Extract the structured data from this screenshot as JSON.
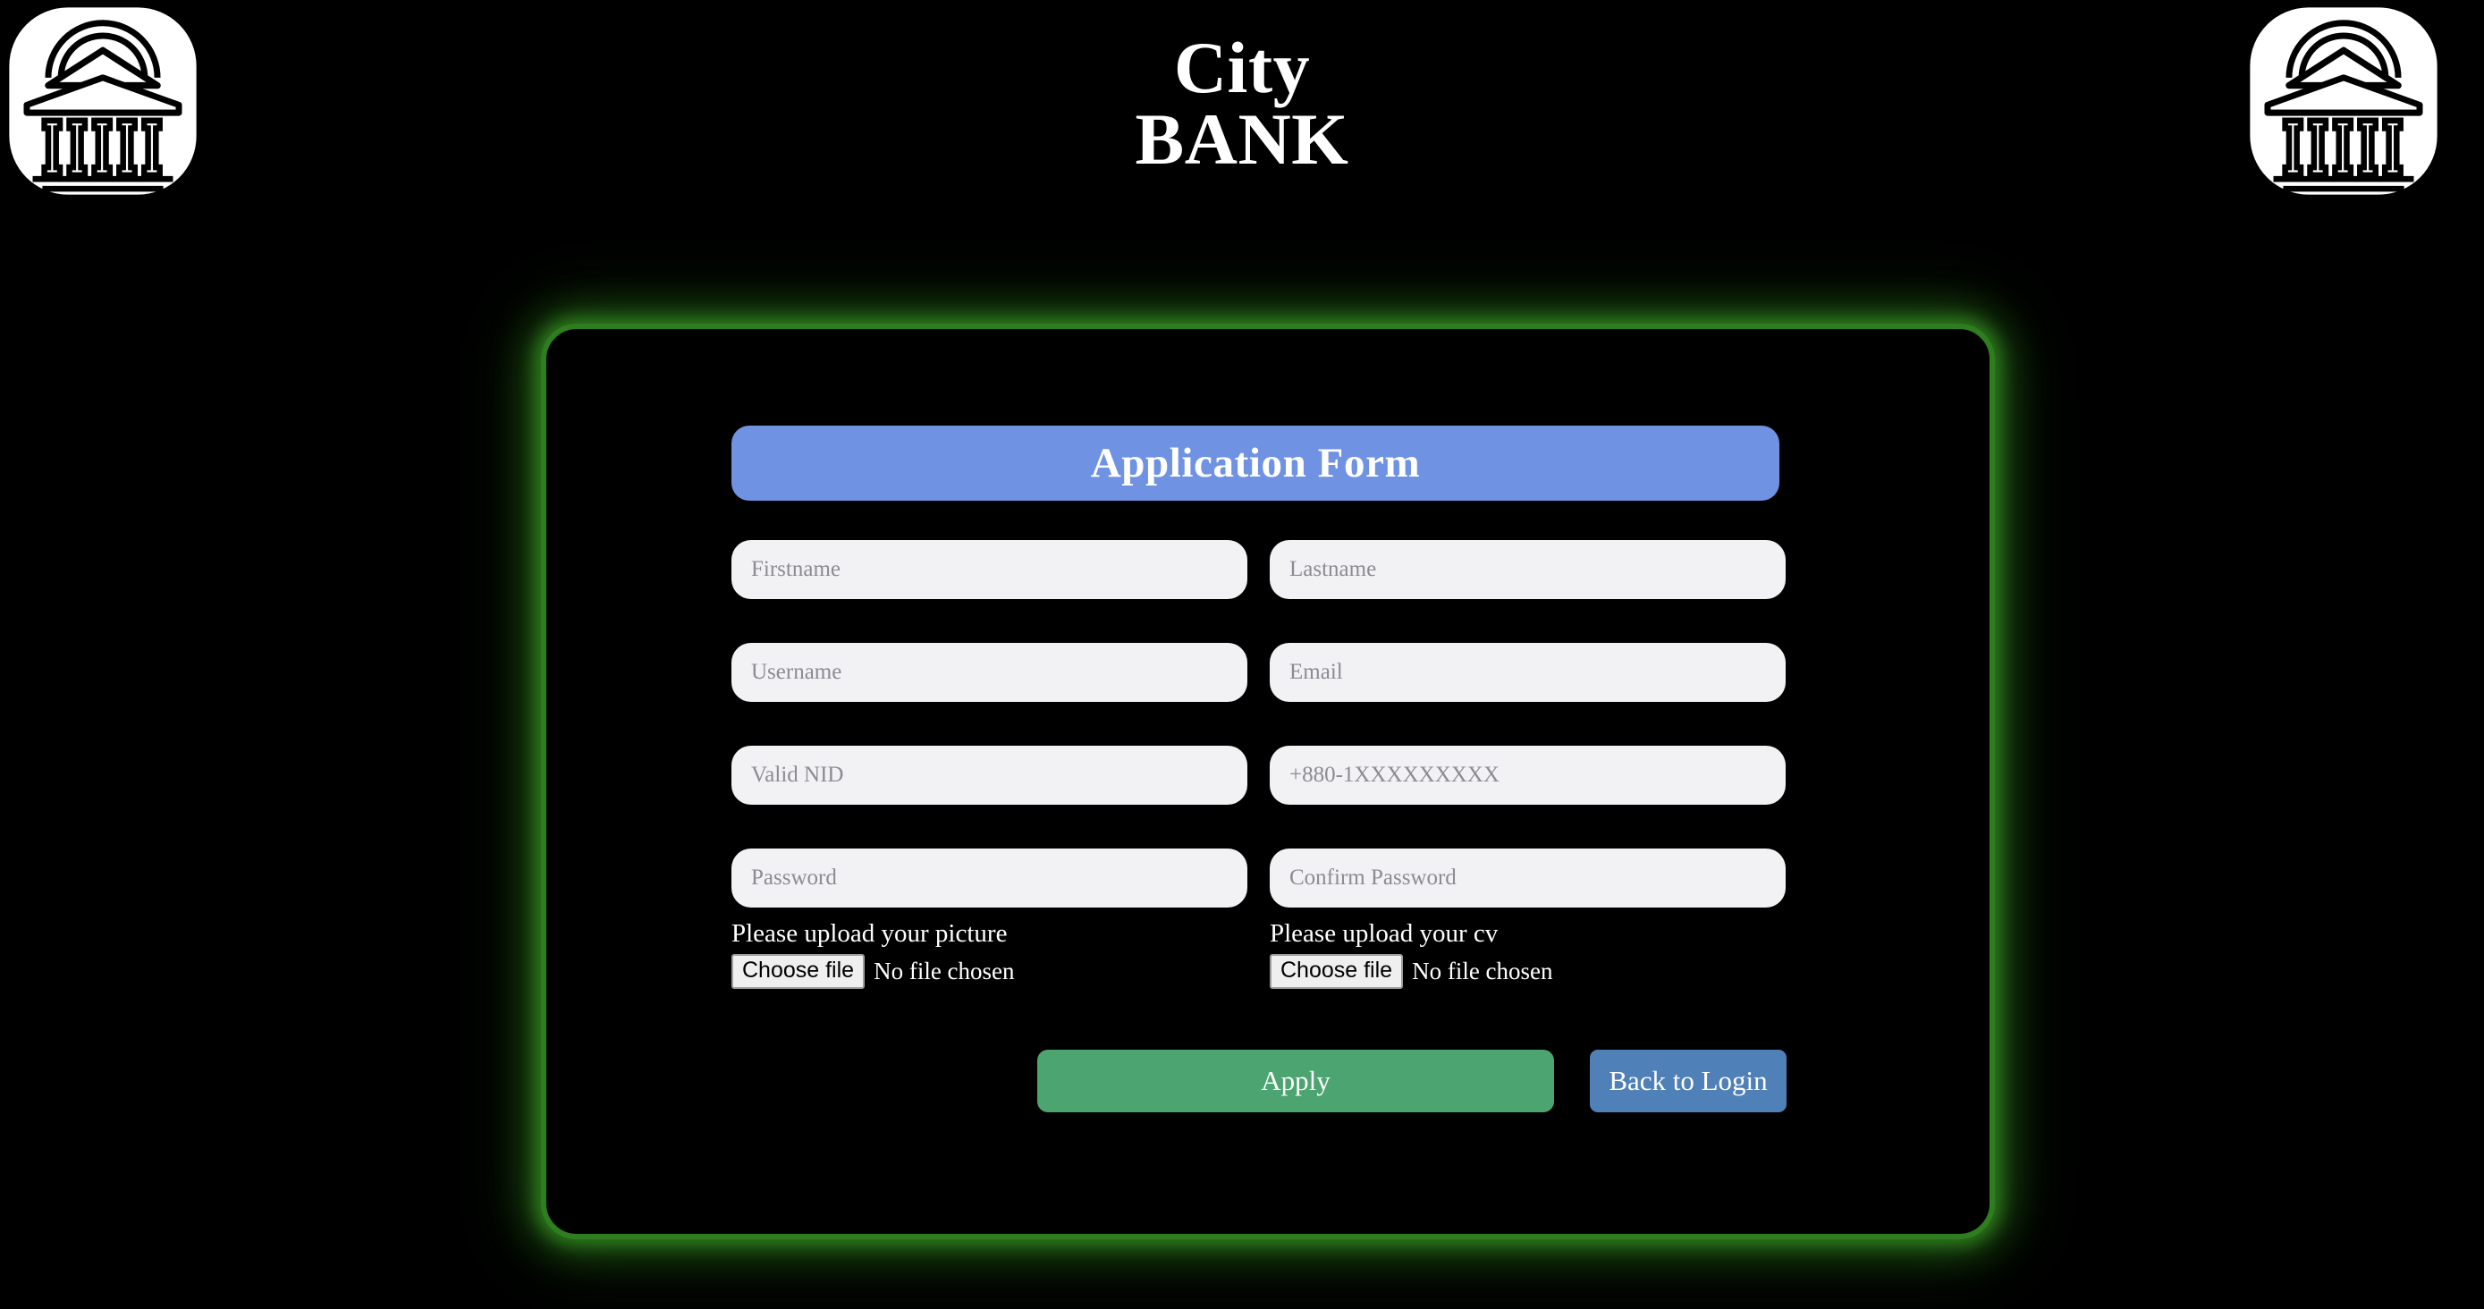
{
  "header": {
    "brand_line1": "City",
    "brand_line2": "BANK",
    "logo_icon_left": "bank-building-icon",
    "logo_icon_right": "bank-building-icon"
  },
  "form": {
    "title": "Application Form",
    "title_bar_color": "#6f92e2",
    "card_border_color": "#2e7d1e",
    "card_background": "#000000",
    "input_background": "#f2f2f5",
    "fields": [
      {
        "name": "firstname",
        "placeholder": "Firstname",
        "value": "",
        "type": "text"
      },
      {
        "name": "lastname",
        "placeholder": "Lastname",
        "value": "",
        "type": "text"
      },
      {
        "name": "username",
        "placeholder": "Username",
        "value": "",
        "type": "text"
      },
      {
        "name": "email",
        "placeholder": "Email",
        "value": "",
        "type": "text"
      },
      {
        "name": "valid_nid",
        "placeholder": "Valid NID",
        "value": "",
        "type": "text"
      },
      {
        "name": "phone",
        "placeholder": "+880-1XXXXXXXXX",
        "value": "",
        "type": "text"
      },
      {
        "name": "password",
        "placeholder": "Password",
        "value": "",
        "type": "password"
      },
      {
        "name": "confirm_password",
        "placeholder": "Confirm Password",
        "value": "",
        "type": "password"
      }
    ],
    "uploads": [
      {
        "name": "picture",
        "label": "Please upload your picture",
        "button_label": "Choose file",
        "status": "No file chosen"
      },
      {
        "name": "cv",
        "label": "Please upload your cv",
        "button_label": "Choose file",
        "status": "No file chosen"
      }
    ],
    "actions": {
      "apply_label": "Apply",
      "apply_color": "#4ca471",
      "back_label": "Back to Login",
      "back_color": "#5080b8"
    }
  }
}
